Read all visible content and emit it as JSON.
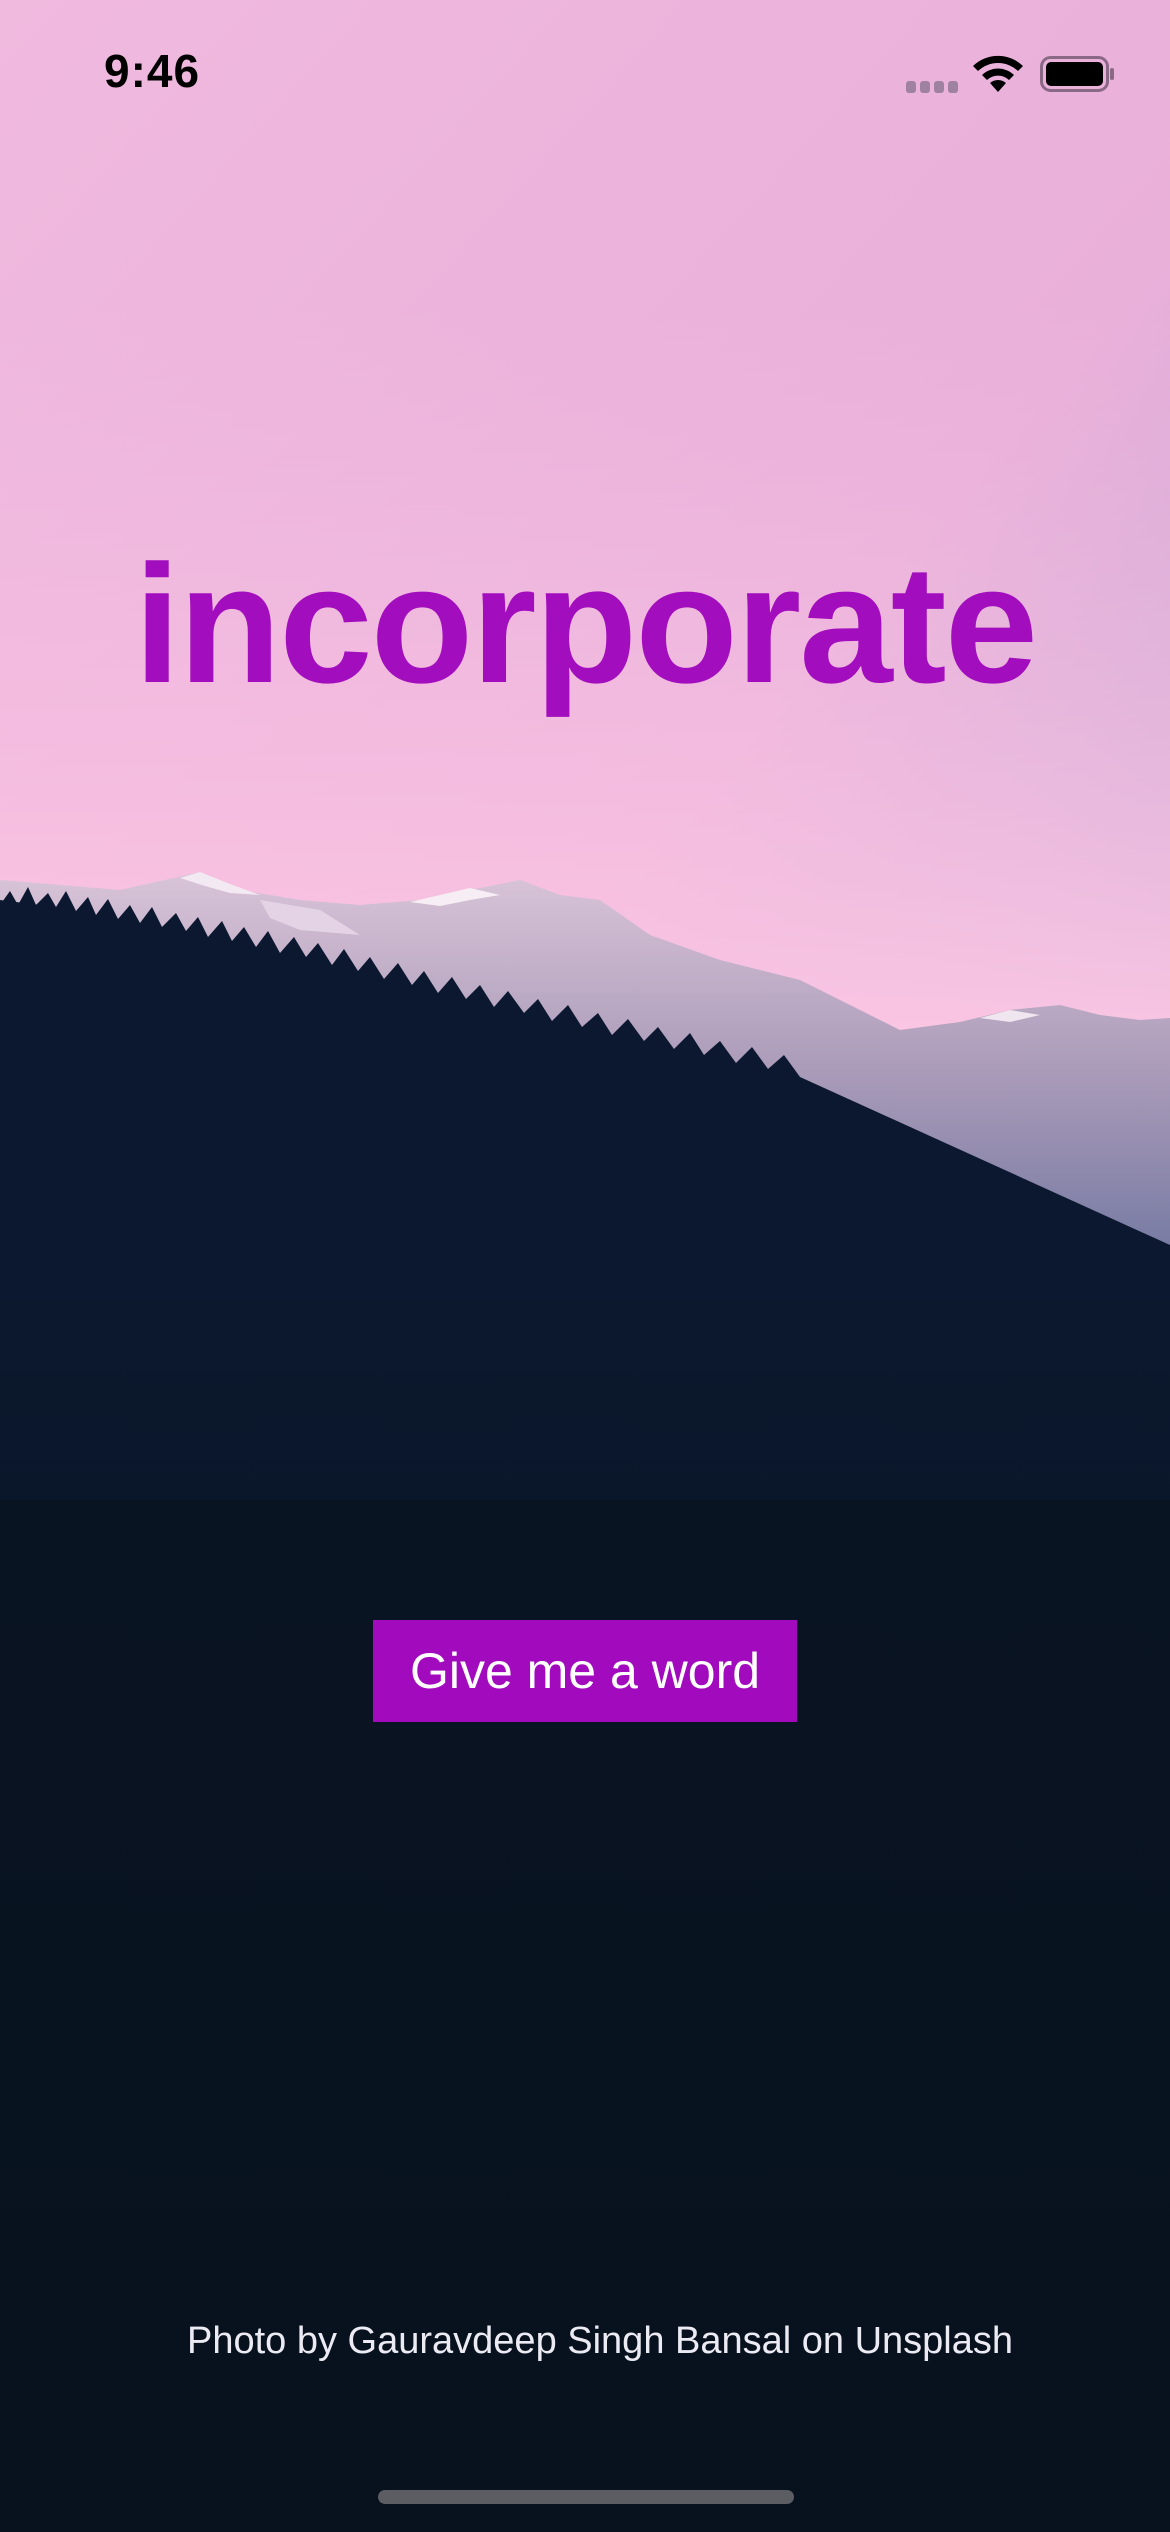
{
  "status_bar": {
    "time": "9:46",
    "icons": [
      "signal-icon",
      "wifi-icon",
      "battery-icon"
    ]
  },
  "main": {
    "word": "incorporate",
    "button_label": "Give me a word",
    "photo_credit": "Photo by Gauravdeep Singh Bansal on Unsplash"
  },
  "colors": {
    "accent": "#a20dbd",
    "button_bg": "#a10bbd",
    "sky_top": "#c7a1d6",
    "sky_bottom": "#ffc6e3",
    "forest": "#0a1424"
  }
}
